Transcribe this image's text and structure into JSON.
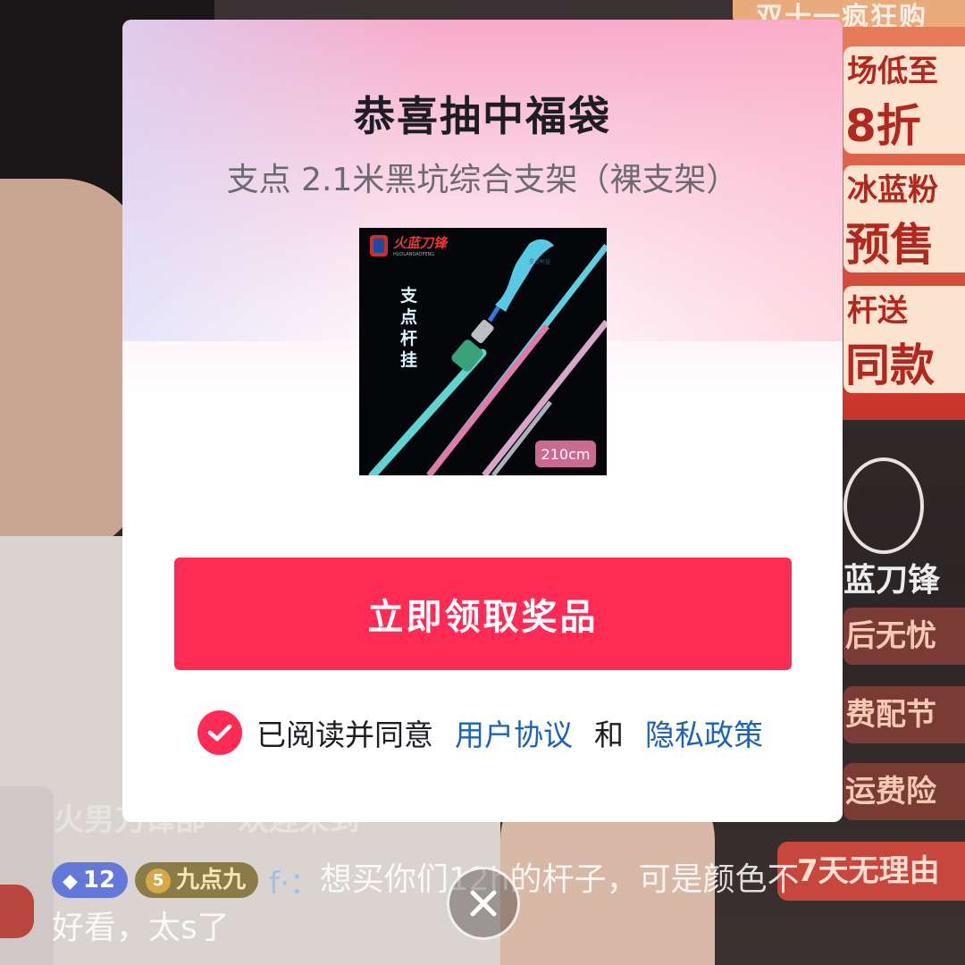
{
  "background": {
    "banner_top": "双十一疯狂购",
    "promo_cards": [
      {
        "line1": "场低至",
        "line2": "8折"
      },
      {
        "line1": "冰蓝粉",
        "line2": "预售"
      },
      {
        "line1": "杆送",
        "line2": "同款"
      }
    ],
    "brand_name": "蓝刀锋",
    "side_tags": [
      "后无忧",
      "费配节",
      "运费险"
    ],
    "seven_day_tag": "7天无理由",
    "faded_comment": "火男刀锋部 · 欢迎来到"
  },
  "chat": {
    "fan_badge_level": "12",
    "club_badge_level": "5",
    "club_badge_name": "九点九",
    "username": "f·：",
    "message": "想买你们12h的杆子，可是颜色不好看，太s了"
  },
  "modal": {
    "title": "恭喜抽中福袋",
    "subtitle": "支点 2.1米黑坑综合支架（裸支架）",
    "prize_image": {
      "brand": "火蓝刀锋",
      "brand_sub": "HUOLANDAOFENG",
      "vertical_text": "支点杆挂",
      "size_label": "210cm"
    },
    "claim_button": "立即领取奖品",
    "agree_prefix": "已阅读并同意",
    "user_agreement": "用户协议",
    "and": "和",
    "privacy_policy": "隐私政策"
  },
  "colors": {
    "accent": "#fe2c55",
    "link": "#1a63b6"
  },
  "icons": {
    "check": "check-icon",
    "close": "close-icon"
  }
}
